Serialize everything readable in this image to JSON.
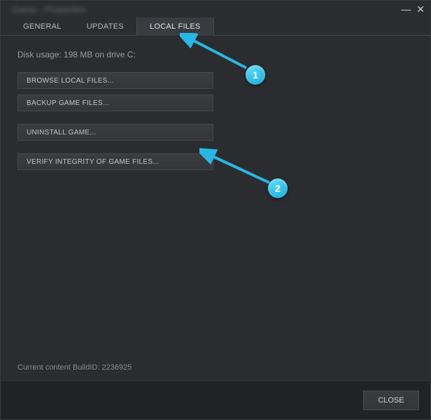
{
  "titlebar": {
    "title": "Game - Properties"
  },
  "tabs": {
    "general": "GENERAL",
    "updates": "UPDATES",
    "local_files": "LOCAL FILES"
  },
  "content": {
    "disk_usage": "Disk usage: 198 MB on drive C:",
    "browse": "BROWSE LOCAL FILES...",
    "backup": "BACKUP GAME FILES...",
    "uninstall": "UNINSTALL GAME...",
    "verify": "VERIFY INTEGRITY OF GAME FILES...",
    "build_id": "Current content BuildID: 2236925"
  },
  "footer": {
    "close": "CLOSE"
  },
  "annotations": {
    "one": "1",
    "two": "2"
  },
  "colors": {
    "accent": "#29b7e5"
  }
}
